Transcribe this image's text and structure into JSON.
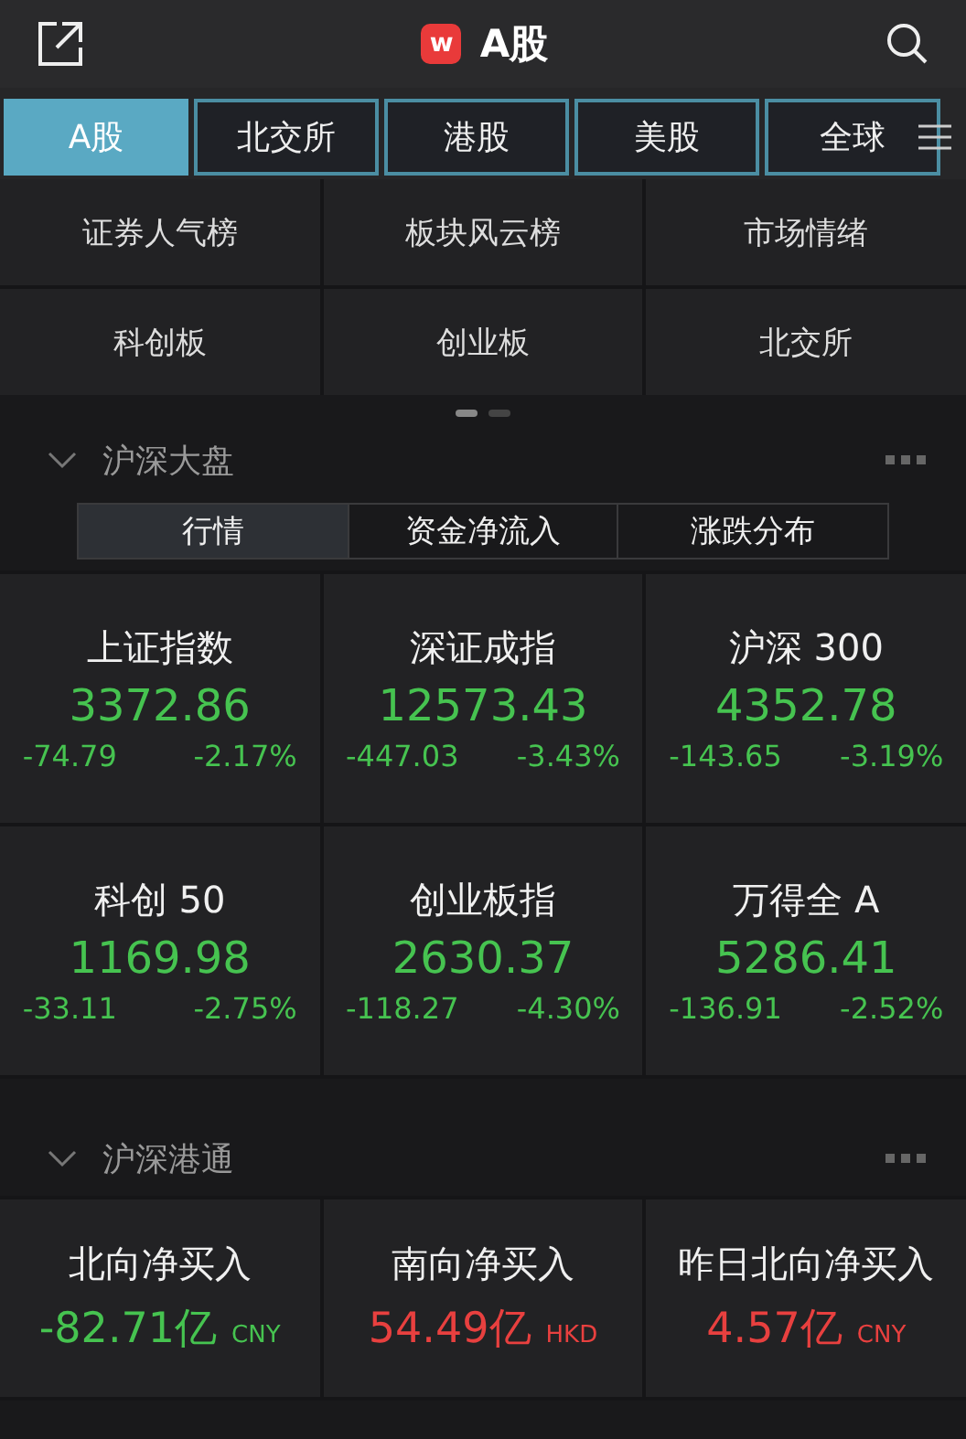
{
  "header": {
    "logo": "w",
    "title": "A股"
  },
  "tabs": [
    {
      "label": "A股",
      "selected": true
    },
    {
      "label": "北交所",
      "selected": false
    },
    {
      "label": "港股",
      "selected": false
    },
    {
      "label": "美股",
      "selected": false
    },
    {
      "label": "全球",
      "selected": false
    }
  ],
  "shortcuts": [
    "证券人气榜",
    "板块风云榜",
    "市场情绪",
    "科创板",
    "创业板",
    "北交所"
  ],
  "pager": [
    {
      "selected": true
    },
    {
      "selected": false
    }
  ],
  "market": {
    "title": "沪深大盘",
    "expanded": true,
    "segments": [
      {
        "label": "行情",
        "selected": true
      },
      {
        "label": "资金净流入",
        "selected": false
      },
      {
        "label": "涨跌分布",
        "selected": false
      }
    ],
    "indices": [
      {
        "name": "上证指数",
        "price": "3372.86",
        "change": "-74.79",
        "percent": "-2.17%",
        "color": "#46c350"
      },
      {
        "name": "深证成指",
        "price": "12573.43",
        "change": "-447.03",
        "percent": "-3.43%",
        "color": "#46c350"
      },
      {
        "name": "沪深 300",
        "price": "4352.78",
        "change": "-143.65",
        "percent": "-3.19%",
        "color": "#46c350"
      },
      {
        "name": "科创 50",
        "price": "1169.98",
        "change": "-33.11",
        "percent": "-2.75%",
        "color": "#46c350"
      },
      {
        "name": "创业板指",
        "price": "2630.37",
        "change": "-118.27",
        "percent": "-4.30%",
        "color": "#46c350"
      },
      {
        "name": "万得全 A",
        "price": "5286.41",
        "change": "-136.91",
        "percent": "-2.52%",
        "color": "#46c350"
      }
    ]
  },
  "connect": {
    "title": "沪深港通",
    "expanded": true,
    "flows": [
      {
        "name": "北向净买入",
        "amount": "-82.71亿",
        "currency": "CNY",
        "color": "#46c350"
      },
      {
        "name": "南向净买入",
        "amount": "54.49亿",
        "currency": "HKD",
        "color": "#e8403f"
      },
      {
        "name": "昨日北向净买入",
        "amount": "4.57亿",
        "currency": "CNY",
        "color": "#e8403f"
      }
    ]
  }
}
